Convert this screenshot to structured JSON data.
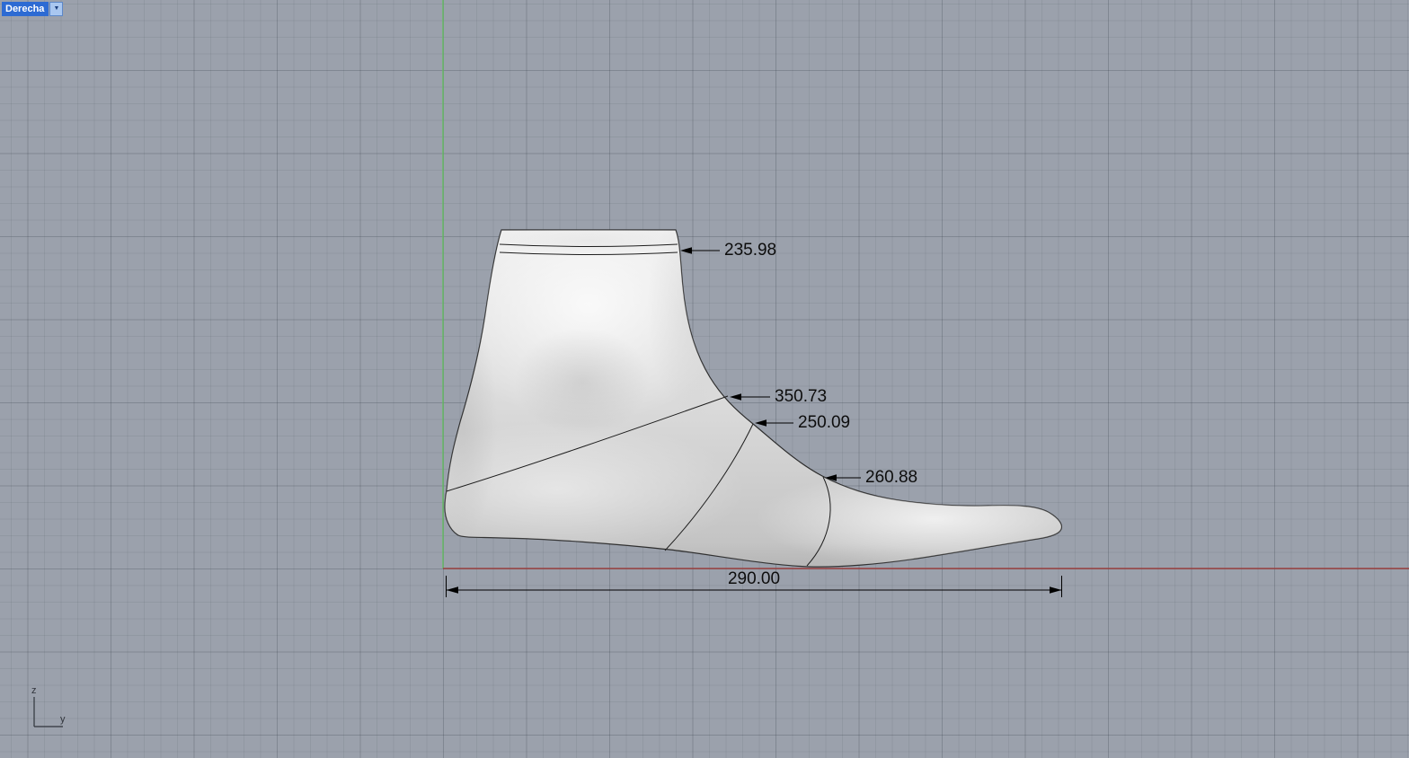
{
  "viewport": {
    "title": "Derecha",
    "dropdown_icon": "▼"
  },
  "dimensions": {
    "topline_girth": {
      "value": "235.98"
    },
    "instep_girth": {
      "value": "350.73"
    },
    "waist_girth": {
      "value": "250.09"
    },
    "ball_girth": {
      "value": "260.88"
    },
    "last_length": {
      "value": "290.00"
    }
  },
  "axis_gizmo": {
    "z_label": "z",
    "y_label": "y"
  },
  "colors": {
    "viewport_background": "#9ba1ac",
    "vertical_axis_green": "#63bb63",
    "horizontal_axis_red": "#9a4040",
    "viewport_label_bg": "#2d6bd3",
    "annotation_text": "#0d0d0d",
    "model_fill_light": "#efefef",
    "model_fill_dark": "#c2c2c2"
  }
}
